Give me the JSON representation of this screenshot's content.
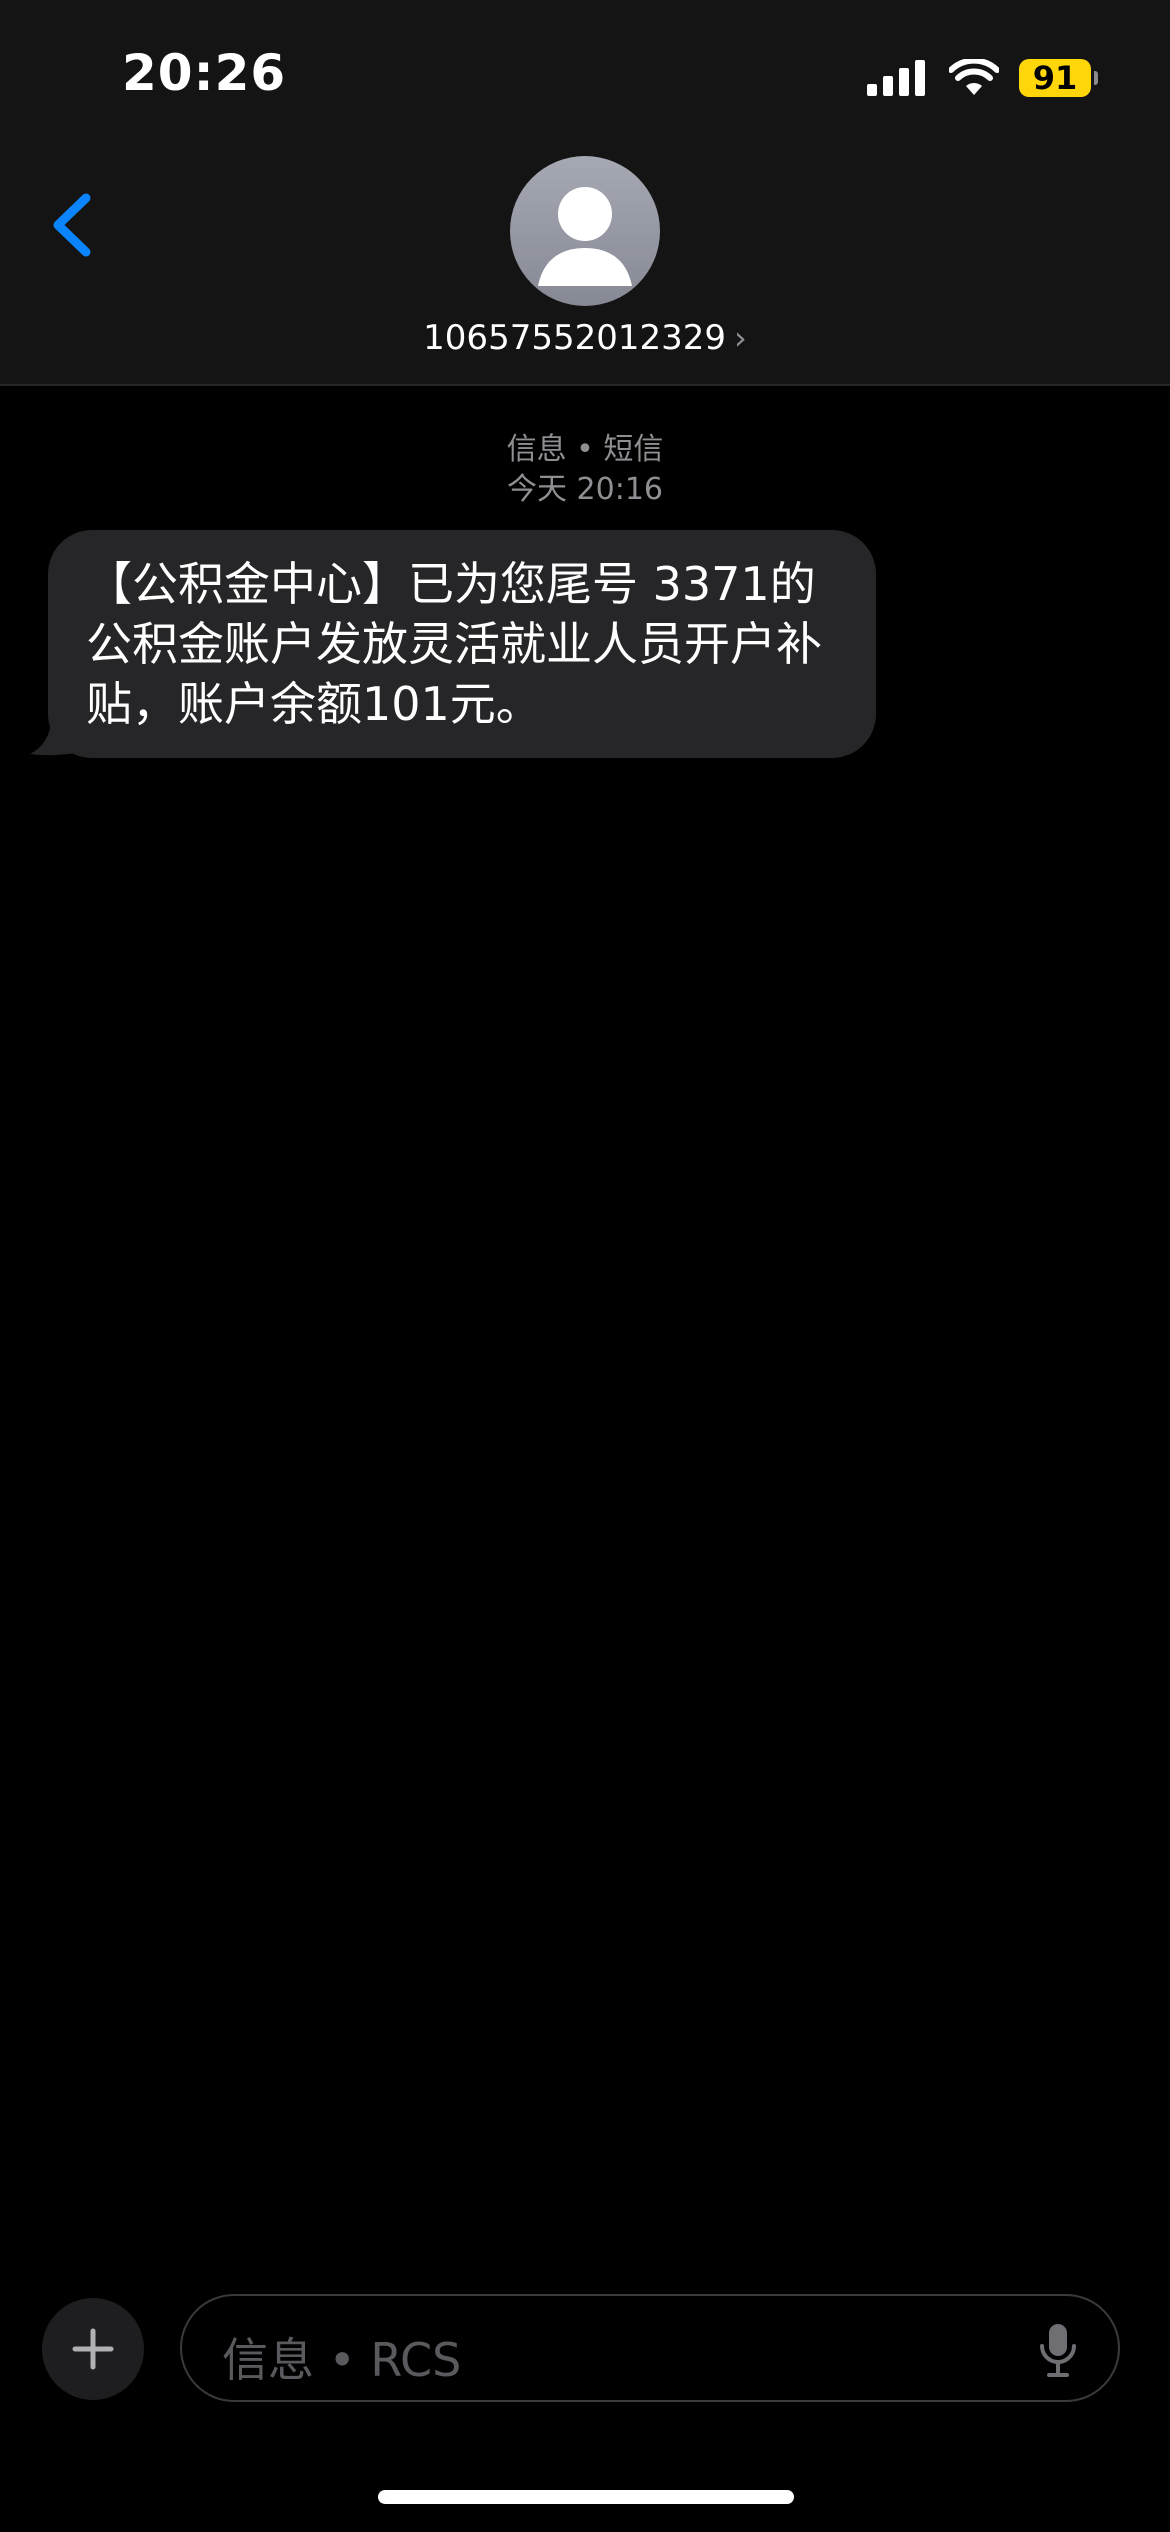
{
  "status_bar": {
    "time": "20:26",
    "battery_level": "91",
    "battery_color": "#ffd60a"
  },
  "header": {
    "contact_number": "10657552012329",
    "back_icon": "chevron-left-icon",
    "accent_color": "#0a84ff"
  },
  "conversation": {
    "service_label": "信息 • 短信",
    "timestamp": "今天 20:16",
    "messages": [
      {
        "direction": "incoming",
        "text": "【公积金中心】已为您尾号 3371的公积金账户发放灵活就业人员开户补贴，账户余额101元。"
      }
    ]
  },
  "composer": {
    "placeholder": "信息 • RCS",
    "add_icon": "plus-icon",
    "mic_icon": "microphone-icon"
  }
}
